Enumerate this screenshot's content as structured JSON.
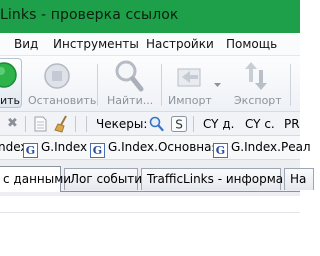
{
  "window": {
    "title": "Links - проверка ссылок"
  },
  "menu": {
    "items": [
      "Вид",
      "Инструменты",
      "Настройки",
      "Помощь"
    ]
  },
  "toolbar": {
    "start_label": "ить",
    "stop_label": "Остановить",
    "find_label": "Найти...",
    "import_label": "Импорт",
    "export_label": "Экспорт"
  },
  "toolbar2": {
    "checkers_label": "Чекеры:",
    "cy_d_label": "CY д.",
    "cy_s_label": "CY с.",
    "pr_label": "PR"
  },
  "favorites": {
    "items": [
      "ndex",
      "G.Index",
      "G.Index.Основная",
      "G.Index.Реал"
    ],
    "g_letter": "G"
  },
  "tabs": {
    "items": [
      "с данными",
      "Лог событий",
      "TrafficLinks - информация",
      "На"
    ],
    "active_index": 0
  },
  "colors": {
    "titlebar": "#1ea04a",
    "accent_green": "#2db34a",
    "disabled_text": "#8c939c"
  }
}
